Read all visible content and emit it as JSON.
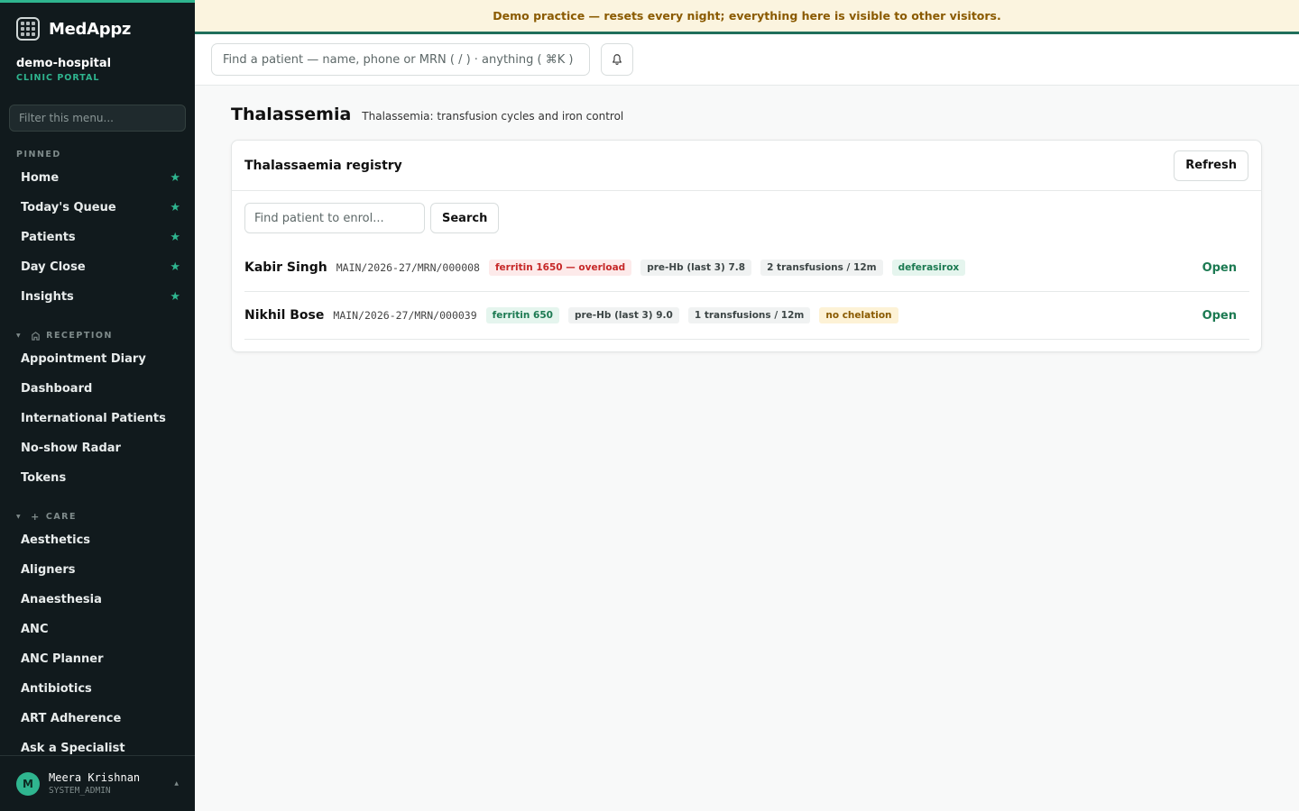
{
  "brand": {
    "name": "MedAppz"
  },
  "org": {
    "name": "demo-hospital",
    "subtitle": "CLINIC PORTAL"
  },
  "sidebar": {
    "filter_placeholder": "Filter this menu...",
    "pinned_label": "PINNED",
    "pinned": [
      {
        "label": "Home"
      },
      {
        "label": "Today's Queue"
      },
      {
        "label": "Patients"
      },
      {
        "label": "Day Close"
      },
      {
        "label": "Insights"
      }
    ],
    "reception_label": "RECEPTION",
    "reception": [
      {
        "label": "Appointment Diary"
      },
      {
        "label": "Dashboard"
      },
      {
        "label": "International Patients"
      },
      {
        "label": "No-show Radar"
      },
      {
        "label": "Tokens"
      }
    ],
    "care_label": "CARE",
    "care": [
      {
        "label": "Aesthetics"
      },
      {
        "label": "Aligners"
      },
      {
        "label": "Anaesthesia"
      },
      {
        "label": "ANC"
      },
      {
        "label": "ANC Planner"
      },
      {
        "label": "Antibiotics"
      },
      {
        "label": "ART Adherence"
      },
      {
        "label": "Ask a Specialist"
      }
    ]
  },
  "user": {
    "initial": "M",
    "name": "Meera Krishnan",
    "role": "SYSTEM_ADMIN"
  },
  "banner": {
    "text": "Demo practice — resets every night; everything here is visible to other visitors."
  },
  "topbar": {
    "search_placeholder": "Find a patient — name, phone or MRN ( / ) · anything ( ⌘K )"
  },
  "page": {
    "title": "Thalassemia",
    "subtitle": "Thalassemia: transfusion cycles and iron control"
  },
  "registry": {
    "title": "Thalassaemia registry",
    "refresh_label": "Refresh",
    "enrol_placeholder": "Find patient to enrol...",
    "search_label": "Search",
    "open_label": "Open",
    "patients": [
      {
        "name": "Kabir Singh",
        "mrn": "MAIN/2026-27/MRN/000008",
        "ferritin": "ferritin 1650 — overload",
        "prehb": "pre-Hb (last 3) 7.8",
        "transfusions": "2 transfusions / 12m",
        "chelation": "deferasirox"
      },
      {
        "name": "Nikhil Bose",
        "mrn": "MAIN/2026-27/MRN/000039",
        "ferritin": "ferritin 650",
        "prehb": "pre-Hb (last 3) 9.0",
        "transfusions": "1 transfusions / 12m",
        "chelation": "no chelation"
      }
    ]
  },
  "colors": {
    "accent": "#2fb58f",
    "sidebar_bg": "#111a1d",
    "banner_bg": "#fbf4df",
    "banner_text": "#8a5a00",
    "danger": "#c62828",
    "success": "#1c7a52"
  }
}
